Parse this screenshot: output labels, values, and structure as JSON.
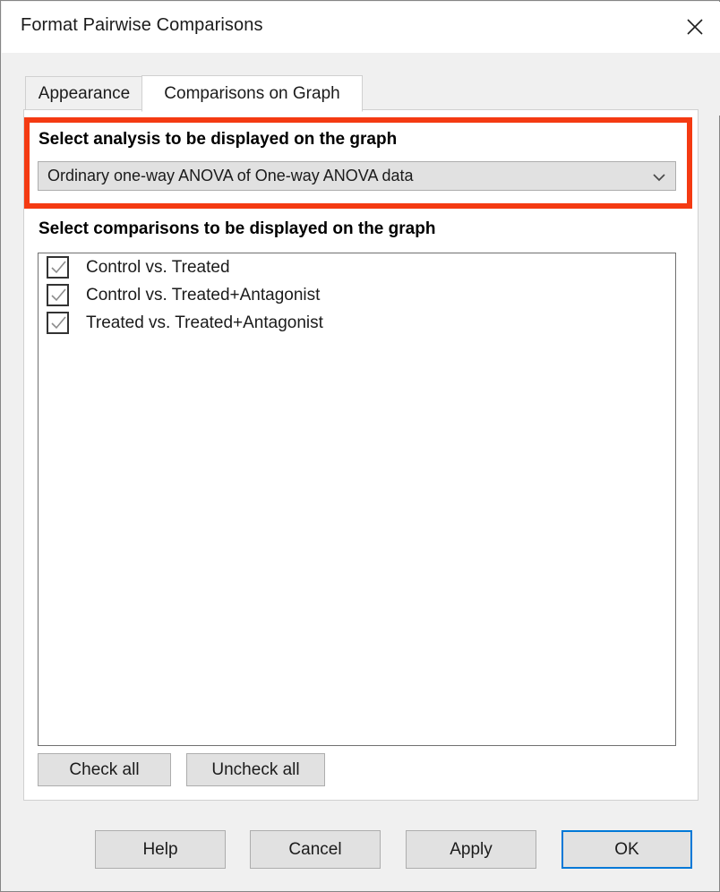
{
  "window": {
    "title": "Format Pairwise Comparisons",
    "close_icon": "close-icon"
  },
  "tabs": [
    {
      "label": "Appearance",
      "active": false,
      "name": "tab-appearance"
    },
    {
      "label": "Comparisons on Graph",
      "active": true,
      "name": "tab-comparisons-on-graph"
    }
  ],
  "analysis_section": {
    "label": "Select analysis to be displayed on the graph",
    "selected": "Ordinary one-way ANOVA of One-way ANOVA data",
    "chevron_icon": "chevron-down-icon",
    "highlight_color": "#f43a12"
  },
  "comparisons_section": {
    "label": "Select comparisons to be displayed on the graph",
    "items": [
      {
        "label": "Control vs. Treated",
        "checked": true
      },
      {
        "label": "Control vs. Treated+Antagonist",
        "checked": true
      },
      {
        "label": "Treated vs. Treated+Antagonist",
        "checked": true
      }
    ],
    "check_all_label": "Check all",
    "uncheck_all_label": "Uncheck all"
  },
  "footer": {
    "help_label": "Help",
    "cancel_label": "Cancel",
    "apply_label": "Apply",
    "ok_label": "OK",
    "ok_focus_color": "#0078d7"
  }
}
